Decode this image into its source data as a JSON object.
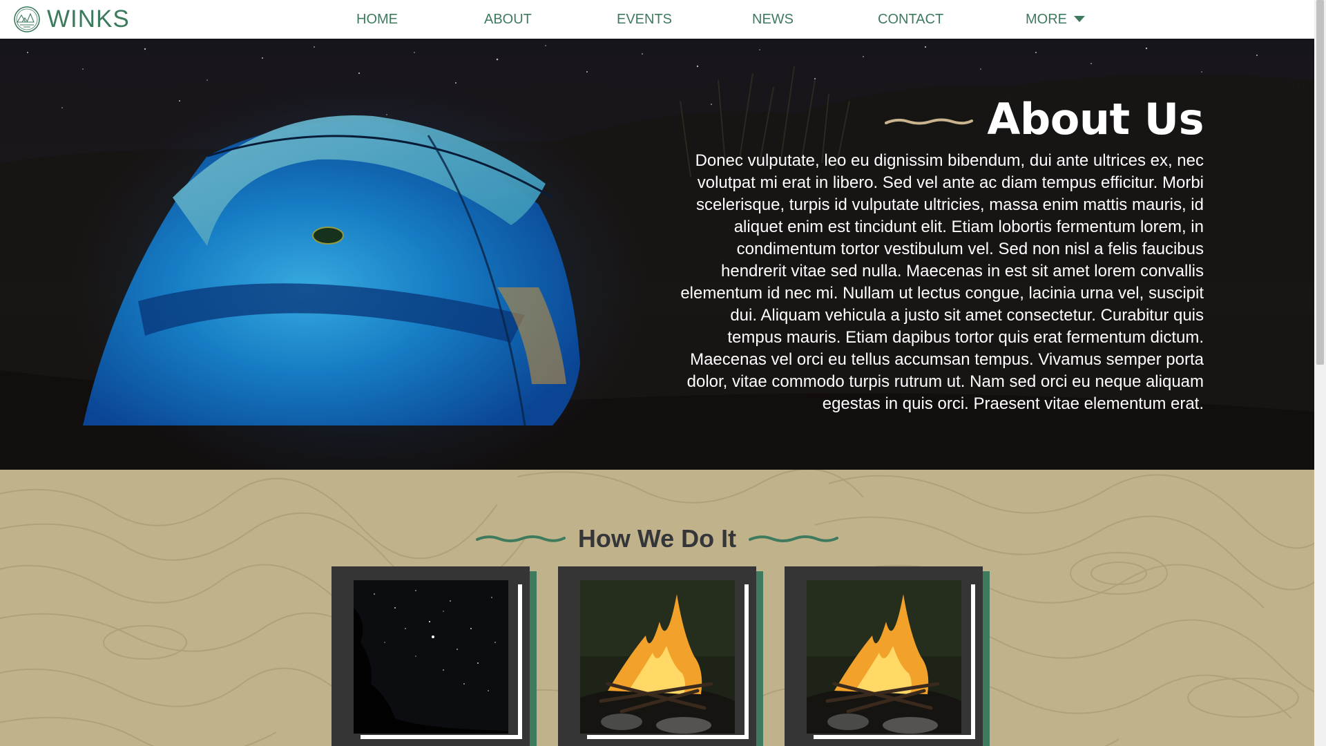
{
  "brand": {
    "name": "WINKS",
    "logo_icon": "campsite-logo-icon"
  },
  "nav": {
    "items": [
      "HOME",
      "ABOUT",
      "EVENTS",
      "NEWS",
      "CONTACT"
    ],
    "more_label": "MORE",
    "more_icon": "caret-down-icon"
  },
  "hero": {
    "title": "About Us",
    "body": "Donec vulputate, leo eu dignissim bibendum, dui ante ultrices ex, nec volutpat mi erat in libero. Sed vel ante ac diam tempus efficitur. Morbi scelerisque, turpis id vulputate ultricies, massa enim mattis mauris, id aliquet enim est tincidunt elit. Etiam lobortis fermentum lorem, in condimentum tortor vestibulum vel. Sed non nisl a felis faucibus hendrerit vitae sed nulla. Maecenas in est sit amet lorem convallis elementum id nec mi. Nullam ut lectus congue, lacinia urna vel, suscipit dui. Aliquam vehicula a justo sit amet consectetur. Curabitur quis tempus mauris. Etiam dapibus tortor quis erat fermentum dictum. Maecenas vel orci eu tellus accumsan tempus. Vivamus semper porta dolor, vitae commodo turpis rutrum ut. Nam sed orci eu neque aliquam egestas in quis orci. Praesent vitae elementum erat."
  },
  "how": {
    "title": "How We Do It",
    "cards": [
      {
        "image": "starry-sky"
      },
      {
        "image": "campfire"
      },
      {
        "image": "campfire"
      }
    ]
  },
  "colors": {
    "accent_green": "#3e7a5d",
    "sand": "#c0b28b",
    "card_dark": "#353535",
    "title_squiggle": "#c9b48e"
  }
}
